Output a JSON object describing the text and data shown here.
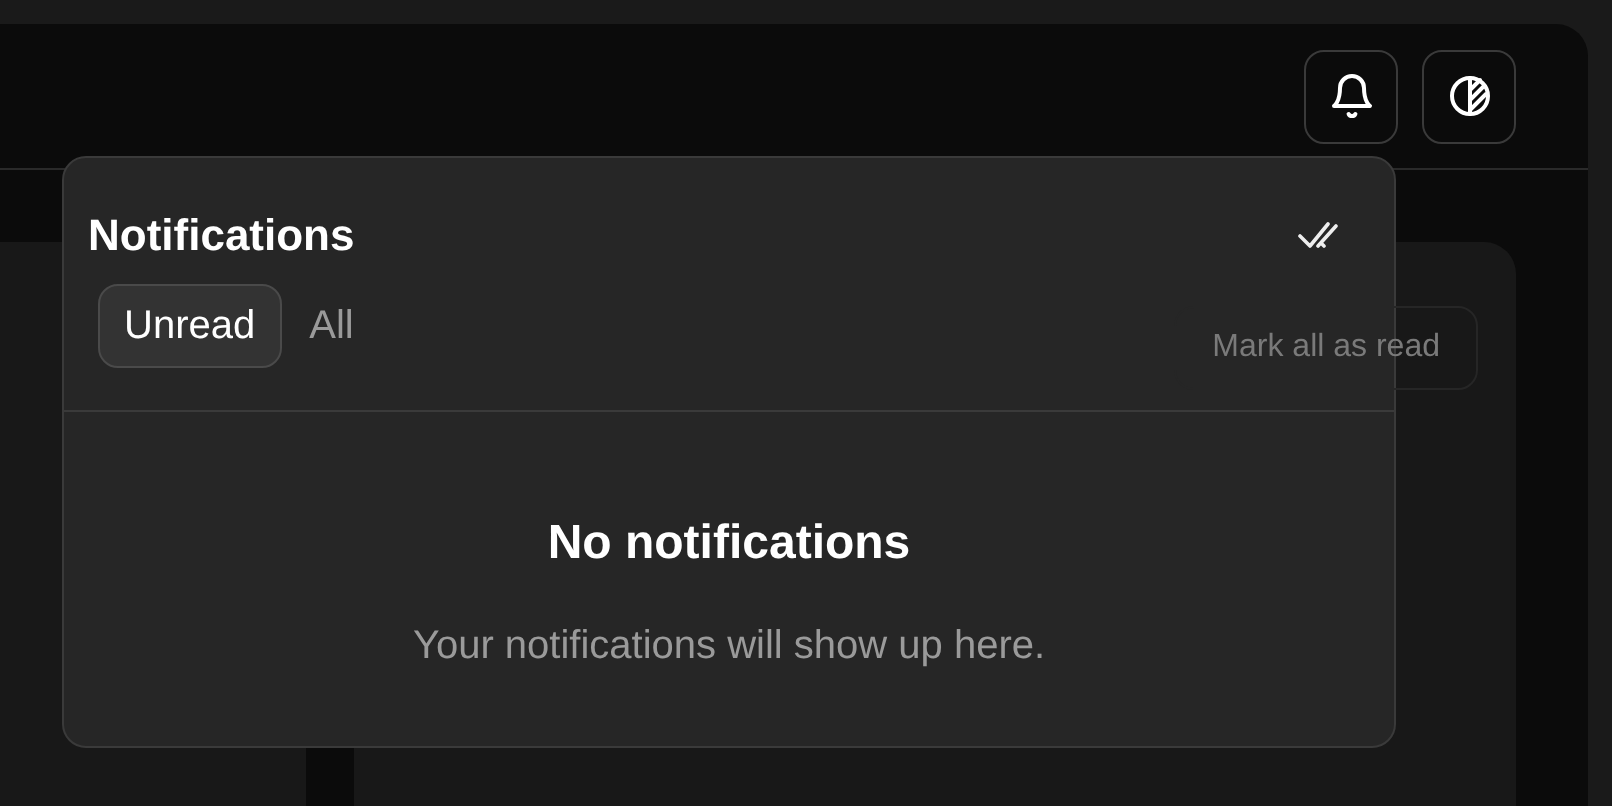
{
  "header": {
    "buttons": [
      {
        "kind": "bell"
      },
      {
        "kind": "theme"
      }
    ]
  },
  "card": {
    "button": "Mark all as read"
  },
  "notifications": {
    "title": "Notifications",
    "tabs": [
      {
        "label": "Unread",
        "selected": true
      },
      {
        "label": "All",
        "selected": false
      }
    ],
    "empty": {
      "title": "No notifications",
      "message": "Your notifications will show up here."
    }
  }
}
